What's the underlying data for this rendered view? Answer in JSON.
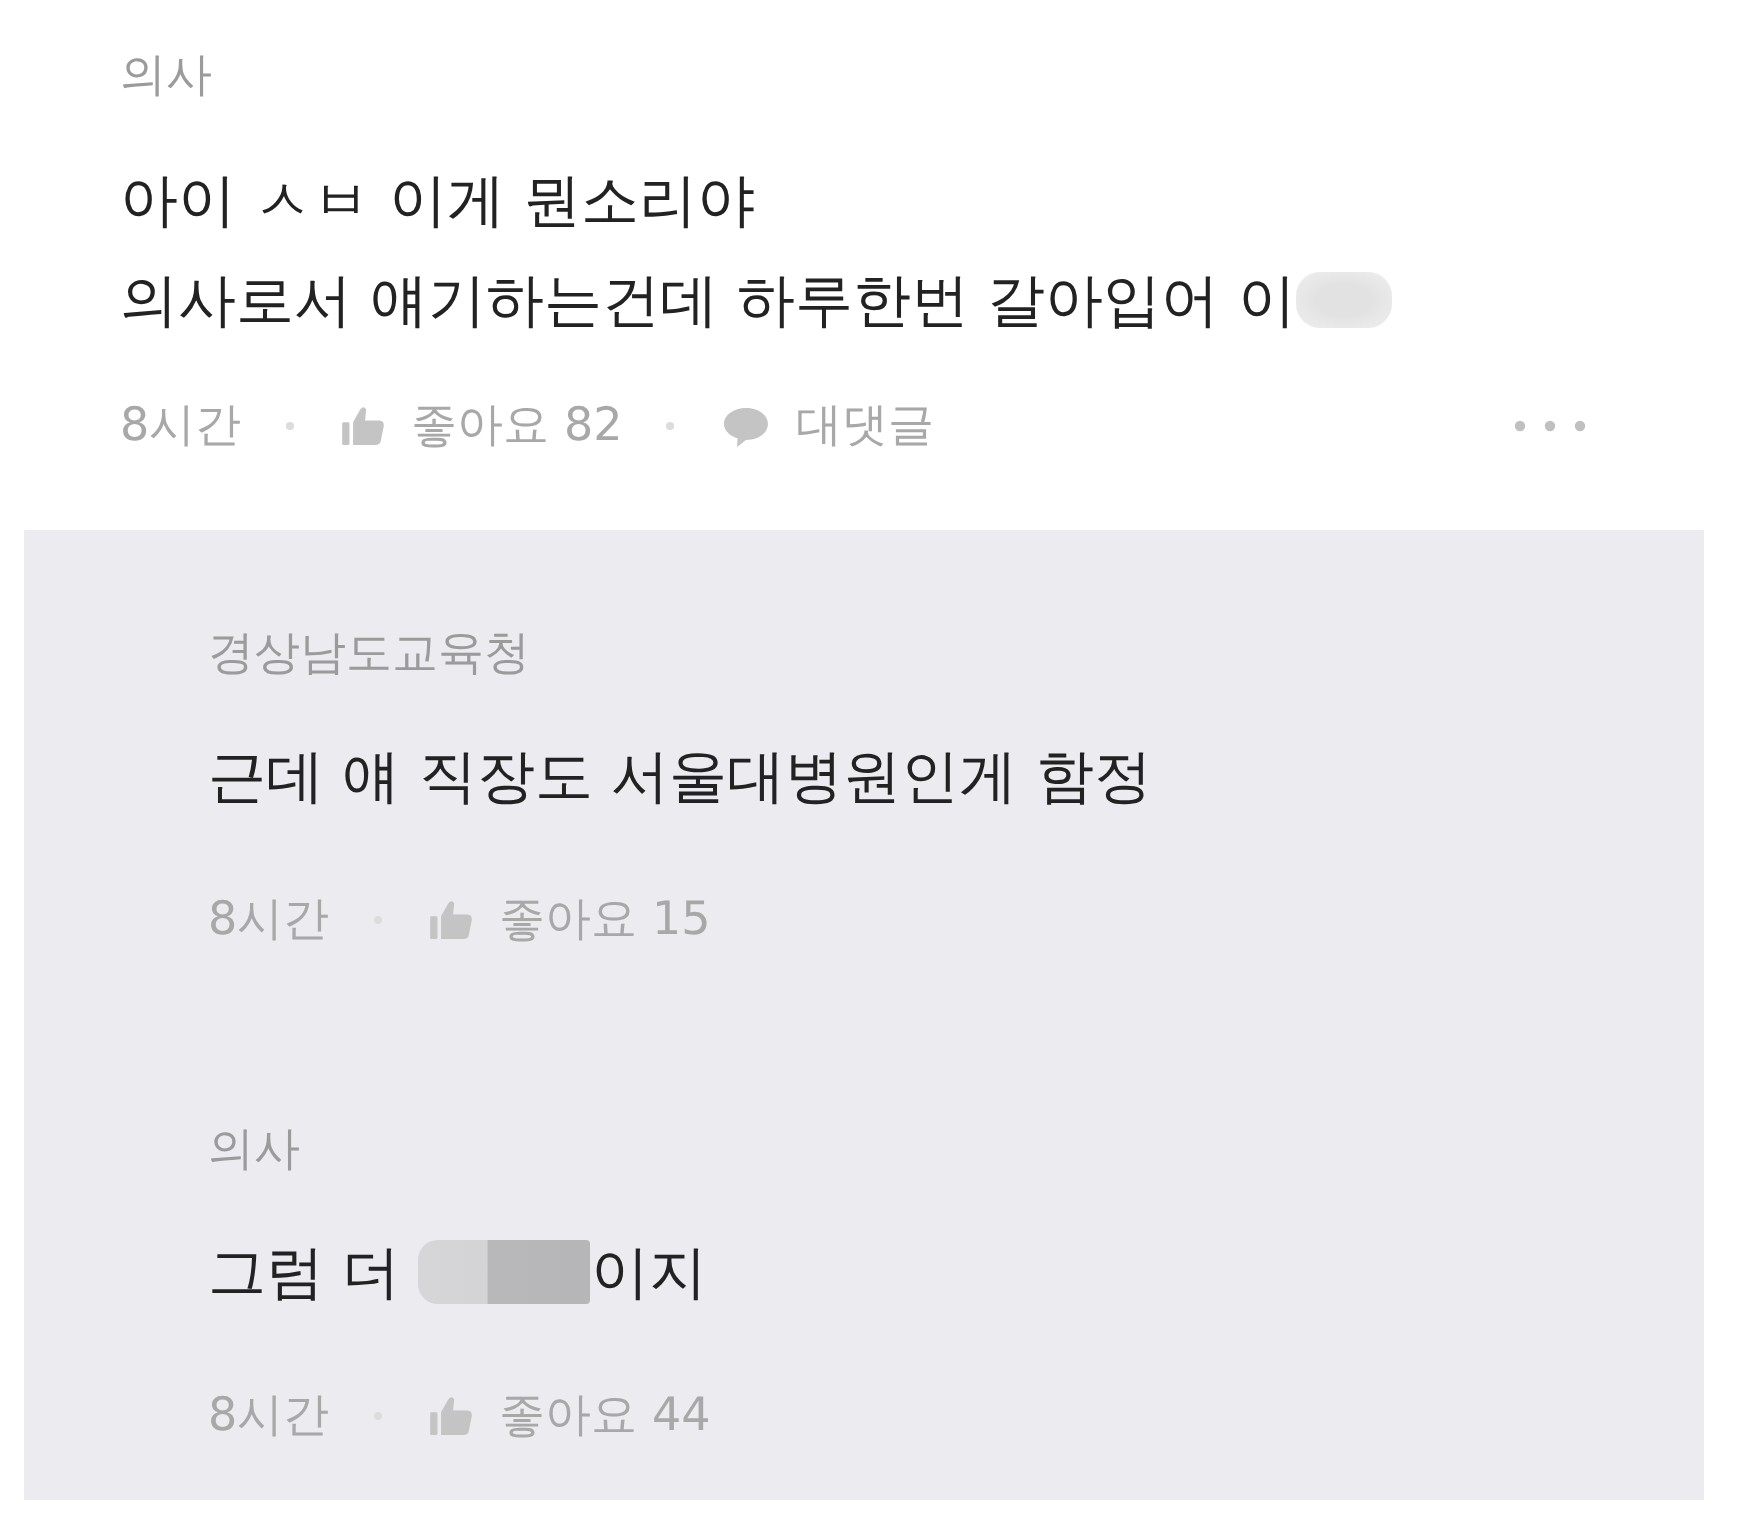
{
  "comment": {
    "author": "의사",
    "lines": [
      [
        {
          "kind": "text",
          "text": "아이 ㅅㅂ 이게 뭔소리야"
        }
      ],
      [
        {
          "kind": "text",
          "text": "의사로서 얘기하는건데 하루한번 갈아입어 이"
        },
        {
          "kind": "blur"
        }
      ]
    ],
    "time": "8시간",
    "like_label": "좋아요 82",
    "reply_label": "대댓글"
  },
  "replies": [
    {
      "author": "경상남도교육청",
      "lines": [
        [
          {
            "kind": "text",
            "text": "근데 얘 직장도 서울대병원인게 함정"
          }
        ]
      ],
      "time": "8시간",
      "like_label": "좋아요 15"
    },
    {
      "author": "의사",
      "lines": [
        [
          {
            "kind": "text",
            "text": "그럼 더 "
          },
          {
            "kind": "mosaic"
          },
          {
            "kind": "text",
            "text": "이지"
          }
        ]
      ],
      "time": "8시간",
      "like_label": "좋아요 44"
    }
  ]
}
